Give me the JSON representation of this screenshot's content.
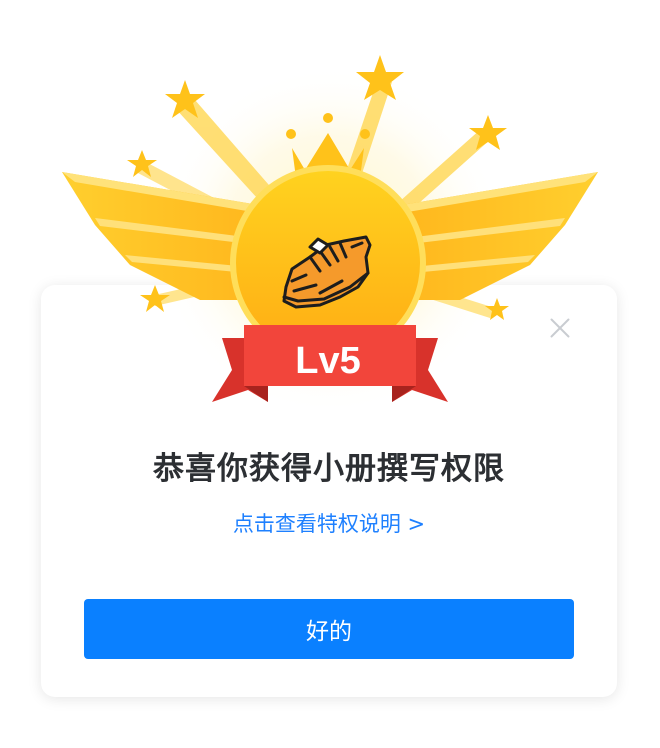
{
  "dialog": {
    "level_badge_text": "Lv5",
    "title": "恭喜你获得小册撰写权限",
    "privilege_link": "点击查看特权说明 >",
    "confirm_label": "好的"
  },
  "colors": {
    "accent": "#1e80ff",
    "button": "#0a80ff",
    "badge_gold": "#ffc21a",
    "ribbon_red": "#f2453b"
  },
  "icons": {
    "close": "close-icon",
    "badge": "shoe-icon",
    "crown": "crown-icon",
    "stars": "star-icon"
  }
}
